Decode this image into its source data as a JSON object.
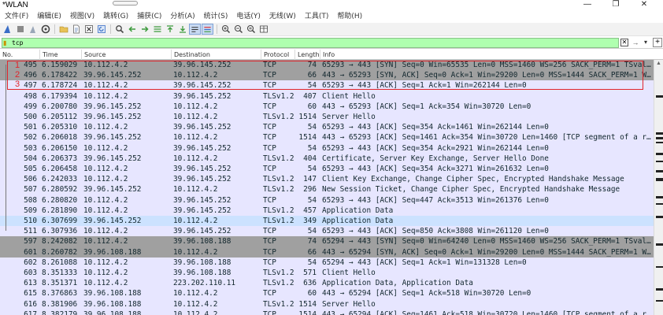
{
  "window": {
    "title": "*WLAN",
    "controls": [
      "—",
      "❐",
      "✕"
    ]
  },
  "menu": [
    "文件(F)",
    "编辑(E)",
    "视图(V)",
    "跳转(G)",
    "捕获(C)",
    "分析(A)",
    "统计(S)",
    "电话(Y)",
    "无线(W)",
    "工具(T)",
    "帮助(H)"
  ],
  "toolbar": {
    "icons": [
      "shark-fin-start-icon",
      "stop-square-icon",
      "restart-shark-icon",
      "capture-options-gear-icon",
      "open-folder-icon",
      "file-icon",
      "close-file-icon",
      "reload-icon",
      "find-packet-icon",
      "go-back-icon",
      "go-forward-icon",
      "go-to-packet-icon",
      "first-packet-icon",
      "last-packet-icon",
      "autoscroll-icon",
      "colorize-icon",
      "zoom-in-icon",
      "zoom-out-icon",
      "zoom-normal-icon",
      "resize-columns-icon"
    ]
  },
  "filter": {
    "value": "tcp",
    "placeholder": ""
  },
  "columns": [
    {
      "key": "no",
      "label": "No."
    },
    {
      "key": "time",
      "label": "Time"
    },
    {
      "key": "source",
      "label": "Source"
    },
    {
      "key": "destination",
      "label": "Destination"
    },
    {
      "key": "protocol",
      "label": "Protocol"
    },
    {
      "key": "length",
      "label": "Length"
    },
    {
      "key": "info",
      "label": "Info"
    }
  ],
  "packets": [
    {
      "no": "495",
      "time": "6.159029",
      "source": "10.112.4.2",
      "destination": "39.96.145.252",
      "protocol": "TCP",
      "length": "74",
      "info": "65293 → 443 [SYN] Seq=0 Win=65535 Len=0 MSS=1460 WS=256 SACK_PERM=1 TSval…",
      "style": "syn"
    },
    {
      "no": "496",
      "time": "6.178422",
      "source": "39.96.145.252",
      "destination": "10.112.4.2",
      "protocol": "TCP",
      "length": "66",
      "info": "443 → 65293 [SYN, ACK] Seq=0 Ack=1 Win=29200 Len=0 MSS=1444 SACK_PERM=1 W…",
      "style": "syn"
    },
    {
      "no": "497",
      "time": "6.178724",
      "source": "10.112.4.2",
      "destination": "39.96.145.252",
      "protocol": "TCP",
      "length": "54",
      "info": "65293 → 443 [ACK] Seq=1 Ack=1 Win=262144 Len=0",
      "style": "tcp"
    },
    {
      "no": "498",
      "time": "6.179394",
      "source": "10.112.4.2",
      "destination": "39.96.145.252",
      "protocol": "TLSv1.2",
      "length": "407",
      "info": "Client Hello",
      "style": "tcp"
    },
    {
      "no": "499",
      "time": "6.200780",
      "source": "39.96.145.252",
      "destination": "10.112.4.2",
      "protocol": "TCP",
      "length": "60",
      "info": "443 → 65293 [ACK] Seq=1 Ack=354 Win=30720 Len=0",
      "style": "tcp"
    },
    {
      "no": "500",
      "time": "6.205112",
      "source": "39.96.145.252",
      "destination": "10.112.4.2",
      "protocol": "TLSv1.2",
      "length": "1514",
      "info": "Server Hello",
      "style": "tcp"
    },
    {
      "no": "501",
      "time": "6.205310",
      "source": "10.112.4.2",
      "destination": "39.96.145.252",
      "protocol": "TCP",
      "length": "54",
      "info": "65293 → 443 [ACK] Seq=354 Ack=1461 Win=262144 Len=0",
      "style": "tcp"
    },
    {
      "no": "502",
      "time": "6.206018",
      "source": "39.96.145.252",
      "destination": "10.112.4.2",
      "protocol": "TCP",
      "length": "1514",
      "info": "443 → 65293 [ACK] Seq=1461 Ack=354 Win=30720 Len=1460 [TCP segment of a r…",
      "style": "tcp"
    },
    {
      "no": "503",
      "time": "6.206150",
      "source": "10.112.4.2",
      "destination": "39.96.145.252",
      "protocol": "TCP",
      "length": "54",
      "info": "65293 → 443 [ACK] Seq=354 Ack=2921 Win=262144 Len=0",
      "style": "tcp"
    },
    {
      "no": "504",
      "time": "6.206373",
      "source": "39.96.145.252",
      "destination": "10.112.4.2",
      "protocol": "TLSv1.2",
      "length": "404",
      "info": "Certificate, Server Key Exchange, Server Hello Done",
      "style": "tcp"
    },
    {
      "no": "505",
      "time": "6.206458",
      "source": "10.112.4.2",
      "destination": "39.96.145.252",
      "protocol": "TCP",
      "length": "54",
      "info": "65293 → 443 [ACK] Seq=354 Ack=3271 Win=261632 Len=0",
      "style": "tcp"
    },
    {
      "no": "506",
      "time": "6.242033",
      "source": "10.112.4.2",
      "destination": "39.96.145.252",
      "protocol": "TLSv1.2",
      "length": "147",
      "info": "Client Key Exchange, Change Cipher Spec, Encrypted Handshake Message",
      "style": "tcp"
    },
    {
      "no": "507",
      "time": "6.280592",
      "source": "39.96.145.252",
      "destination": "10.112.4.2",
      "protocol": "TLSv1.2",
      "length": "296",
      "info": "New Session Ticket, Change Cipher Spec, Encrypted Handshake Message",
      "style": "tcp"
    },
    {
      "no": "508",
      "time": "6.280820",
      "source": "10.112.4.2",
      "destination": "39.96.145.252",
      "protocol": "TCP",
      "length": "54",
      "info": "65293 → 443 [ACK] Seq=447 Ack=3513 Win=261376 Len=0",
      "style": "tcp"
    },
    {
      "no": "509",
      "time": "6.281890",
      "source": "10.112.4.2",
      "destination": "39.96.145.252",
      "protocol": "TLSv1.2",
      "length": "457",
      "info": "Application Data",
      "style": "tcp"
    },
    {
      "no": "510",
      "time": "6.307699",
      "source": "39.96.145.252",
      "destination": "10.112.4.2",
      "protocol": "TLSv1.2",
      "length": "349",
      "info": "Application Data",
      "style": "selected"
    },
    {
      "no": "511",
      "time": "6.307936",
      "source": "10.112.4.2",
      "destination": "39.96.145.252",
      "protocol": "TCP",
      "length": "54",
      "info": "65293 → 443 [ACK] Seq=850 Ack=3808 Win=261120 Len=0",
      "style": "tcp"
    },
    {
      "no": "597",
      "time": "8.242082",
      "source": "10.112.4.2",
      "destination": "39.96.108.188",
      "protocol": "TCP",
      "length": "74",
      "info": "65294 → 443 [SYN] Seq=0 Win=64240 Len=0 MSS=1460 WS=256 SACK_PERM=1 TSval…",
      "style": "syn"
    },
    {
      "no": "601",
      "time": "8.260782",
      "source": "39.96.108.188",
      "destination": "10.112.4.2",
      "protocol": "TCP",
      "length": "66",
      "info": "443 → 65294 [SYN, ACK] Seq=0 Ack=1 Win=29200 Len=0 MSS=1444 SACK_PERM=1 W…",
      "style": "syn"
    },
    {
      "no": "602",
      "time": "8.261088",
      "source": "10.112.4.2",
      "destination": "39.96.108.188",
      "protocol": "TCP",
      "length": "54",
      "info": "65294 → 443 [ACK] Seq=1 Ack=1 Win=131328 Len=0",
      "style": "tcp"
    },
    {
      "no": "603",
      "time": "8.351333",
      "source": "10.112.4.2",
      "destination": "39.96.108.188",
      "protocol": "TLSv1.2",
      "length": "571",
      "info": "Client Hello",
      "style": "tcp"
    },
    {
      "no": "613",
      "time": "8.351371",
      "source": "10.112.4.2",
      "destination": "223.202.110.11",
      "protocol": "TLSv1.2",
      "length": "636",
      "info": "Application Data, Application Data",
      "style": "tcp"
    },
    {
      "no": "615",
      "time": "8.376863",
      "source": "39.96.108.188",
      "destination": "10.112.4.2",
      "protocol": "TCP",
      "length": "60",
      "info": "443 → 65294 [ACK] Seq=1 Ack=518 Win=30720 Len=0",
      "style": "tcp"
    },
    {
      "no": "616",
      "time": "8.381906",
      "source": "39.96.108.188",
      "destination": "10.112.4.2",
      "protocol": "TLSv1.2",
      "length": "1514",
      "info": "Server Hello",
      "style": "tcp"
    },
    {
      "no": "617",
      "time": "8.382179",
      "source": "39.96.108.188",
      "destination": "10.112.4.2",
      "protocol": "TCP",
      "length": "1514",
      "info": "443 → 65294 [ACK] Seq=1461 Ack=518 Win=30720 Len=1460 [TCP segment of a r…",
      "style": "tcp"
    }
  ],
  "annotations": {
    "labels": [
      "1",
      "2",
      "3"
    ],
    "color": "#e0252b"
  },
  "colors": {
    "tcp_row": "#e7e6ff",
    "syn_row": "#a0a0a0",
    "selected_row": "#cce2ff",
    "filter_valid": "#afffaf"
  }
}
